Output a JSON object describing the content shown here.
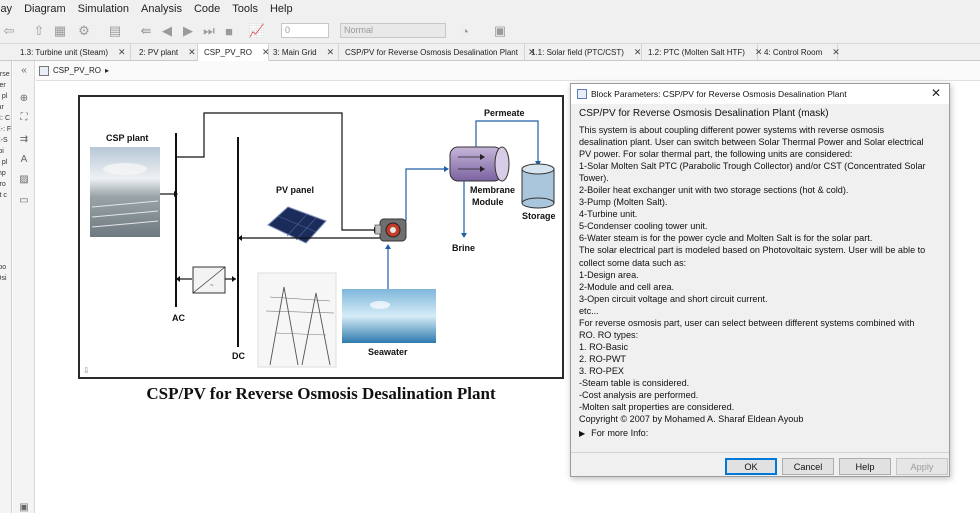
{
  "menu": [
    "lay",
    "Diagram",
    "Simulation",
    "Analysis",
    "Code",
    "Tools",
    "Help"
  ],
  "toolbar": {
    "sim_time_value": "0",
    "sim_mode_value": "Normal"
  },
  "tabs": [
    {
      "label": "1.3: Turbine unit (Steam)",
      "active": false
    },
    {
      "label": "2: PV plant",
      "active": false
    },
    {
      "label": "CSP_PV_RO",
      "active": true
    },
    {
      "label": "3: Main Grid",
      "active": false
    },
    {
      "label": "CSP/PV for Reverse Osmosis Desalination Plant",
      "active": false
    },
    {
      "label": "1.1: Solar field (PTC/CST)",
      "active": false
    },
    {
      "label": "1.2: PTC (Molten Salt HTF)",
      "active": false
    },
    {
      "label": "4: Control Room",
      "active": false
    }
  ],
  "left_panel_items": [
    "erse",
    "ver",
    "o pl",
    "lar",
    "C: C",
    "X-: F",
    "X-S",
    "rbi",
    "o pl",
    "mp",
    "cro",
    "st c",
    "",
    "",
    "",
    "",
    "it",
    "roo",
    "Osi"
  ],
  "breadcrumb": {
    "label": "CSP_PV_RO",
    "arrow": "▸"
  },
  "diagram": {
    "labels": {
      "csp_plant": "CSP plant",
      "pv_panel": "PV panel",
      "ac": "AC",
      "dc": "DC",
      "seawater": "Seawater",
      "permeate": "Permeate",
      "membrane": "Membrane",
      "module": "Module",
      "storage": "Storage",
      "brine": "Brine"
    },
    "caption": "CSP/PV for Reverse Osmosis Desalination Plant"
  },
  "dialog": {
    "title": "Block Parameters: CSP/PV for Reverse Osmosis Desalination Plant",
    "header": "CSP/PV for Reverse Osmosis Desalination Plant  (mask)",
    "lines": [
      "This system is about coupling different power systems with reverse osmosis",
      "desalination plant. User can switch between Solar Thermal Power and Solar electrical",
      "PV power. For solar thermal part, the following units are considered:",
      "1-Solar Molten Salt PTC (Parabolic Trough Collector) and/or CST (Concentrated Solar",
      "Tower).",
      "2-Boiler heat exchanger unit with two storage sections (hot & cold).",
      "3-Pump (Molten Salt).",
      "4-Turbine unit.",
      "5-Condenser cooling tower unit.",
      "6-Water steam is for the power cycle and Molten Salt is for the solar part.",
      "The solar electrical part is modeled based on Photovoltaic system. User will be able to",
      "collect some data such as:",
      "1-Design area.",
      "2-Module and cell area.",
      "3-Open circuit voltage and short circuit current.",
      "etc...",
      "For reverse osmosis part, user can select between different systems combined with",
      "RO. RO types:",
      "1. RO-Basic",
      "2. RO-PWT",
      "3. RO-PEX",
      "-Steam table is considered.",
      "-Cost analysis are performed.",
      "-Molten salt properties are considered.",
      "Copyright © 2007 by Mohamed A. Sharaf Eldean Ayoub"
    ],
    "more_info": "For more Info:",
    "buttons": {
      "ok": "OK",
      "cancel": "Cancel",
      "help": "Help",
      "apply": "Apply"
    }
  }
}
